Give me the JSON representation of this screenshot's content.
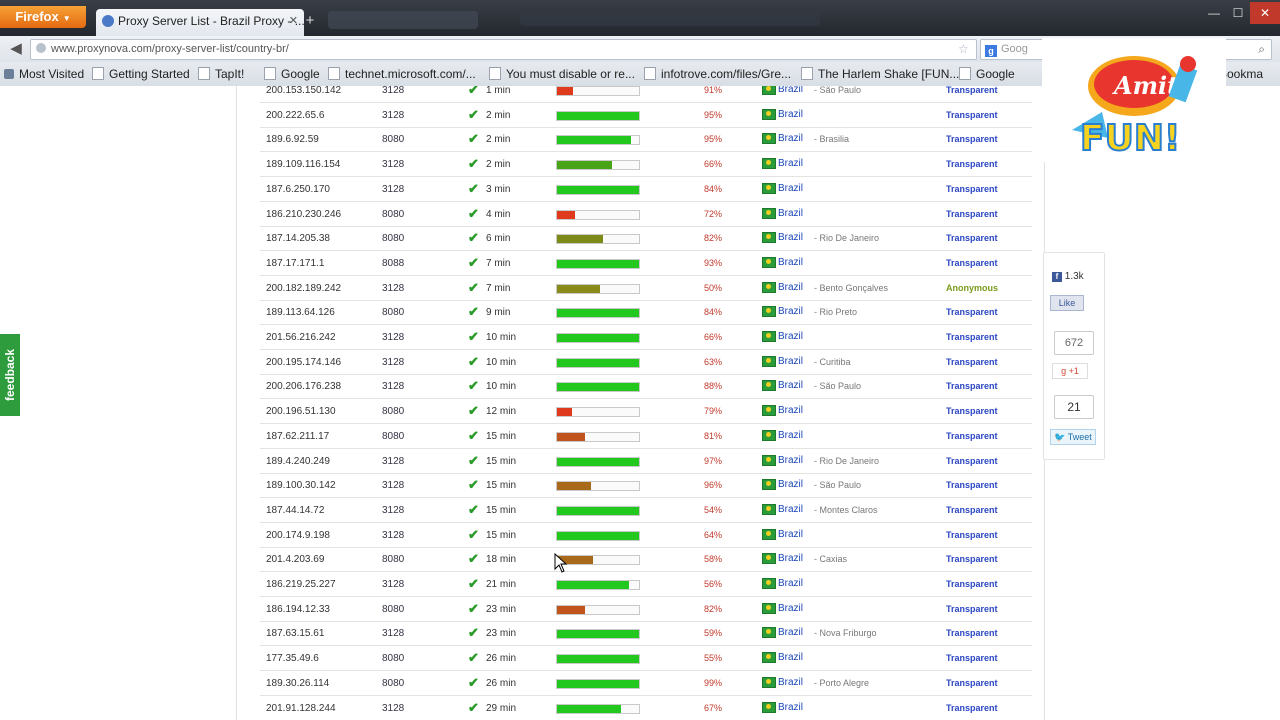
{
  "browser": {
    "menu_label": "Firefox",
    "tab_title": "Proxy Server List - Brazil Proxy - ...",
    "new_tab": "+",
    "url": "www.proxynova.com/proxy-server-list/country-br/",
    "search_placeholder": "Goog",
    "bookmarks": [
      "Most Visited",
      "Getting Started",
      "TapIt!",
      "Google",
      "technet.microsoft.com/...",
      "You must disable or re...",
      "infotrove.com/files/Gre...",
      "The Harlem Shake [FUN...",
      "Google",
      "Bookma"
    ],
    "icons": {
      "back": "back-arrow-icon",
      "reload": "reload-icon",
      "star": "bookmark-star-icon",
      "search": "search-icon"
    }
  },
  "proxy_rows": [
    {
      "ip": "200.153.150.142",
      "port": "3128",
      "time": "1 min",
      "speed": 0.2,
      "speed_color": "#e03a1e",
      "uptime": "91%",
      "country": "Brazil",
      "city": "São Paulo",
      "anonymity": "Transparent"
    },
    {
      "ip": "200.222.65.6",
      "port": "3128",
      "time": "2 min",
      "speed": 1.0,
      "speed_color": "#22c81e",
      "uptime": "95%",
      "country": "Brazil",
      "city": "",
      "anonymity": "Transparent"
    },
    {
      "ip": "189.6.92.59",
      "port": "8080",
      "time": "2 min",
      "speed": 0.9,
      "speed_color": "#22c81e",
      "uptime": "95%",
      "country": "Brazil",
      "city": "Brasilia",
      "anonymity": "Transparent"
    },
    {
      "ip": "189.109.116.154",
      "port": "3128",
      "time": "2 min",
      "speed": 0.67,
      "speed_color": "#4aa418",
      "uptime": "66%",
      "country": "Brazil",
      "city": "",
      "anonymity": "Transparent"
    },
    {
      "ip": "187.6.250.170",
      "port": "3128",
      "time": "3 min",
      "speed": 1.0,
      "speed_color": "#22c81e",
      "uptime": "84%",
      "country": "Brazil",
      "city": "",
      "anonymity": "Transparent"
    },
    {
      "ip": "186.210.230.246",
      "port": "8080",
      "time": "4 min",
      "speed": 0.22,
      "speed_color": "#e03a1e",
      "uptime": "72%",
      "country": "Brazil",
      "city": "",
      "anonymity": "Transparent"
    },
    {
      "ip": "187.14.205.38",
      "port": "8080",
      "time": "6 min",
      "speed": 0.56,
      "speed_color": "#7d8a18",
      "uptime": "82%",
      "country": "Brazil",
      "city": "Rio De Janeiro",
      "anonymity": "Transparent"
    },
    {
      "ip": "187.17.171.1",
      "port": "8088",
      "time": "7 min",
      "speed": 1.0,
      "speed_color": "#22c81e",
      "uptime": "93%",
      "country": "Brazil",
      "city": "",
      "anonymity": "Transparent"
    },
    {
      "ip": "200.182.189.242",
      "port": "3128",
      "time": "7 min",
      "speed": 0.53,
      "speed_color": "#8a8a1a",
      "uptime": "50%",
      "country": "Brazil",
      "city": "Bento Gonçalves",
      "anonymity": "Anonymous"
    },
    {
      "ip": "189.113.64.126",
      "port": "8080",
      "time": "9 min",
      "speed": 1.0,
      "speed_color": "#22c81e",
      "uptime": "84%",
      "country": "Brazil",
      "city": "Rio Preto",
      "anonymity": "Transparent"
    },
    {
      "ip": "201.56.216.242",
      "port": "3128",
      "time": "10 min",
      "speed": 1.0,
      "speed_color": "#22c81e",
      "uptime": "66%",
      "country": "Brazil",
      "city": "",
      "anonymity": "Transparent"
    },
    {
      "ip": "200.195.174.146",
      "port": "3128",
      "time": "10 min",
      "speed": 1.0,
      "speed_color": "#22c81e",
      "uptime": "63%",
      "country": "Brazil",
      "city": "Curitiba",
      "anonymity": "Transparent"
    },
    {
      "ip": "200.206.176.238",
      "port": "3128",
      "time": "10 min",
      "speed": 1.0,
      "speed_color": "#22c81e",
      "uptime": "88%",
      "country": "Brazil",
      "city": "São Paulo",
      "anonymity": "Transparent"
    },
    {
      "ip": "200.196.51.130",
      "port": "8080",
      "time": "12 min",
      "speed": 0.18,
      "speed_color": "#e03a1e",
      "uptime": "79%",
      "country": "Brazil",
      "city": "",
      "anonymity": "Transparent"
    },
    {
      "ip": "187.62.211.17",
      "port": "8080",
      "time": "15 min",
      "speed": 0.34,
      "speed_color": "#c0541c",
      "uptime": "81%",
      "country": "Brazil",
      "city": "",
      "anonymity": "Transparent"
    },
    {
      "ip": "189.4.240.249",
      "port": "3128",
      "time": "15 min",
      "speed": 1.0,
      "speed_color": "#22c81e",
      "uptime": "97%",
      "country": "Brazil",
      "city": "Rio De Janeiro",
      "anonymity": "Transparent"
    },
    {
      "ip": "189.100.30.142",
      "port": "3128",
      "time": "15 min",
      "speed": 0.42,
      "speed_color": "#a86a1a",
      "uptime": "96%",
      "country": "Brazil",
      "city": "São Paulo",
      "anonymity": "Transparent"
    },
    {
      "ip": "187.44.14.72",
      "port": "3128",
      "time": "15 min",
      "speed": 1.0,
      "speed_color": "#22c81e",
      "uptime": "54%",
      "country": "Brazil",
      "city": "Montes Claros",
      "anonymity": "Transparent"
    },
    {
      "ip": "200.174.9.198",
      "port": "3128",
      "time": "15 min",
      "speed": 1.0,
      "speed_color": "#22c81e",
      "uptime": "64%",
      "country": "Brazil",
      "city": "",
      "anonymity": "Transparent"
    },
    {
      "ip": "201.4.203.69",
      "port": "8080",
      "time": "18 min",
      "speed": 0.44,
      "speed_color": "#a86a1a",
      "uptime": "58%",
      "country": "Brazil",
      "city": "Caxias",
      "anonymity": "Transparent"
    },
    {
      "ip": "186.219.25.227",
      "port": "3128",
      "time": "21 min",
      "speed": 0.88,
      "speed_color": "#22c81e",
      "uptime": "56%",
      "country": "Brazil",
      "city": "",
      "anonymity": "Transparent"
    },
    {
      "ip": "186.194.12.33",
      "port": "8080",
      "time": "23 min",
      "speed": 0.34,
      "speed_color": "#c0541c",
      "uptime": "82%",
      "country": "Brazil",
      "city": "",
      "anonymity": "Transparent"
    },
    {
      "ip": "187.63.15.61",
      "port": "3128",
      "time": "23 min",
      "speed": 1.0,
      "speed_color": "#22c81e",
      "uptime": "59%",
      "country": "Brazil",
      "city": "Nova Friburgo",
      "anonymity": "Transparent"
    },
    {
      "ip": "177.35.49.6",
      "port": "8080",
      "time": "26 min",
      "speed": 1.0,
      "speed_color": "#22c81e",
      "uptime": "55%",
      "country": "Brazil",
      "city": "",
      "anonymity": "Transparent"
    },
    {
      "ip": "189.30.26.114",
      "port": "8080",
      "time": "26 min",
      "speed": 1.0,
      "speed_color": "#22c81e",
      "uptime": "99%",
      "country": "Brazil",
      "city": "Porto Alegre",
      "anonymity": "Transparent"
    },
    {
      "ip": "201.91.128.244",
      "port": "3128",
      "time": "29 min",
      "speed": 0.78,
      "speed_color": "#22c81e",
      "uptime": "67%",
      "country": "Brazil",
      "city": "",
      "anonymity": "Transparent"
    }
  ],
  "feedback_label": "feedback",
  "social": {
    "fb_count": "1.3k",
    "fb_like": "Like",
    "gplus_count": "672",
    "gplus_label": "+1",
    "tweet_count": "21",
    "tweet_label": "Tweet"
  },
  "overlay_logo": {
    "text": "Amita FUN!"
  }
}
